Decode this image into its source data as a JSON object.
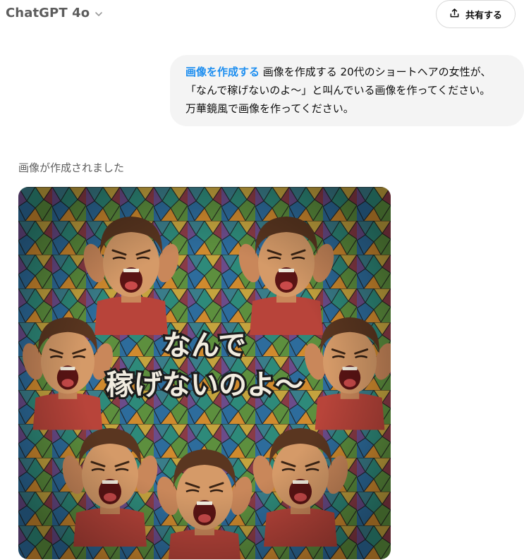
{
  "header": {
    "model_title": "ChatGPT 4o",
    "model_chevron_icon": "chevron-down-icon",
    "share_label": "共有する",
    "share_icon": "share-upload-icon"
  },
  "user_message": {
    "tag": "画像を作成する",
    "line1": " 画像を作成する 20代のショートヘアの女性が、",
    "line2": "「なんで稼げないのよ〜」と叫んでいる画像を作ってください。",
    "line3": "万華鏡風で画像を作ってください。"
  },
  "assistant": {
    "status": "画像が作成されました",
    "image_caption_line1": "なんで",
    "image_caption_line2": "稼げないのよ〜"
  },
  "colors": {
    "accent_link": "#1d8ef0",
    "bubble_bg": "#f4f4f4",
    "muted_text": "#5d5d5d"
  }
}
